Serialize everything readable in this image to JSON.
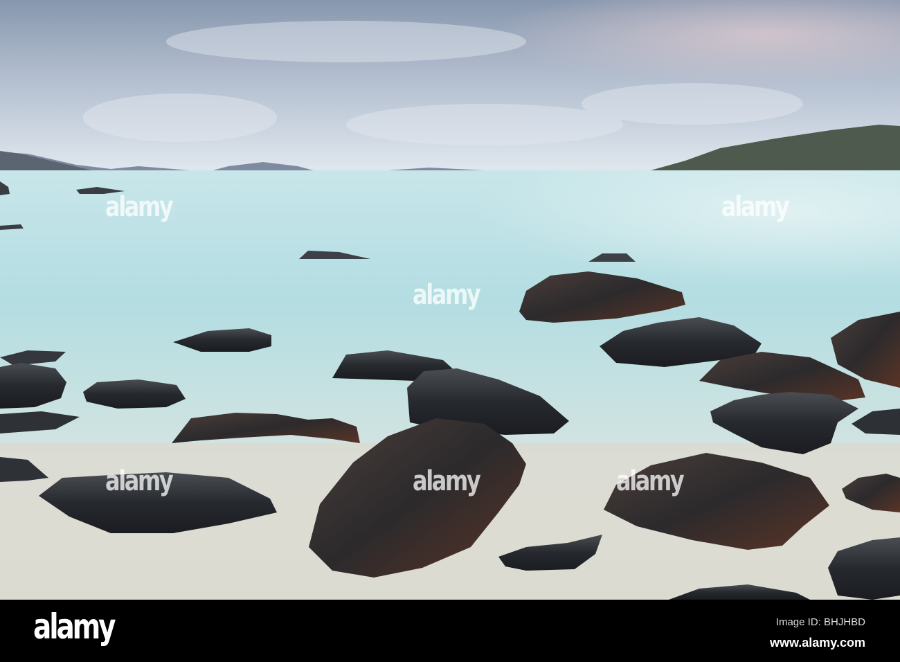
{
  "footer": {
    "logo": "alamy",
    "image_id": "Image ID: BHJHBD",
    "website": "www.alamy.com"
  },
  "watermark": {
    "text": "alamy"
  },
  "colors": {
    "sky_top": "#8a9bb2",
    "sky_bottom": "#dbe3ec",
    "sea": "#bfe1e6",
    "sand": "#dcdcd2",
    "rock": "#24272c"
  }
}
